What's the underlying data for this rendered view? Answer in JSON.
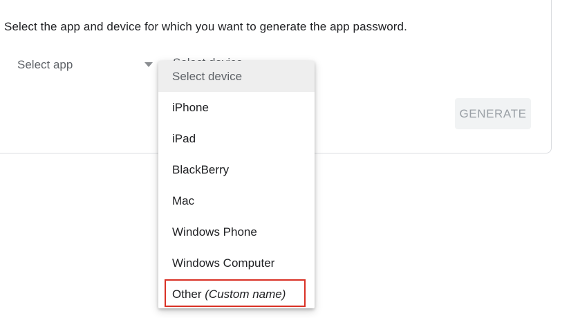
{
  "instruction": "Select the app and device for which you want to generate the app password.",
  "app_select": {
    "label": "Select app",
    "caret_icon": "caret-down-icon"
  },
  "device_select": {
    "label": "Select device"
  },
  "generate_button": {
    "label": "GENERATE"
  },
  "device_dropdown": {
    "header": "Select device",
    "options": [
      "iPhone",
      "iPad",
      "BlackBerry",
      "Mac",
      "Windows Phone",
      "Windows Computer"
    ],
    "other": {
      "label": "Other",
      "hint": "(Custom name)"
    }
  },
  "colors": {
    "highlight_border": "#d93025",
    "header_background": "#eeeeee",
    "button_background": "#f1f3f4"
  }
}
